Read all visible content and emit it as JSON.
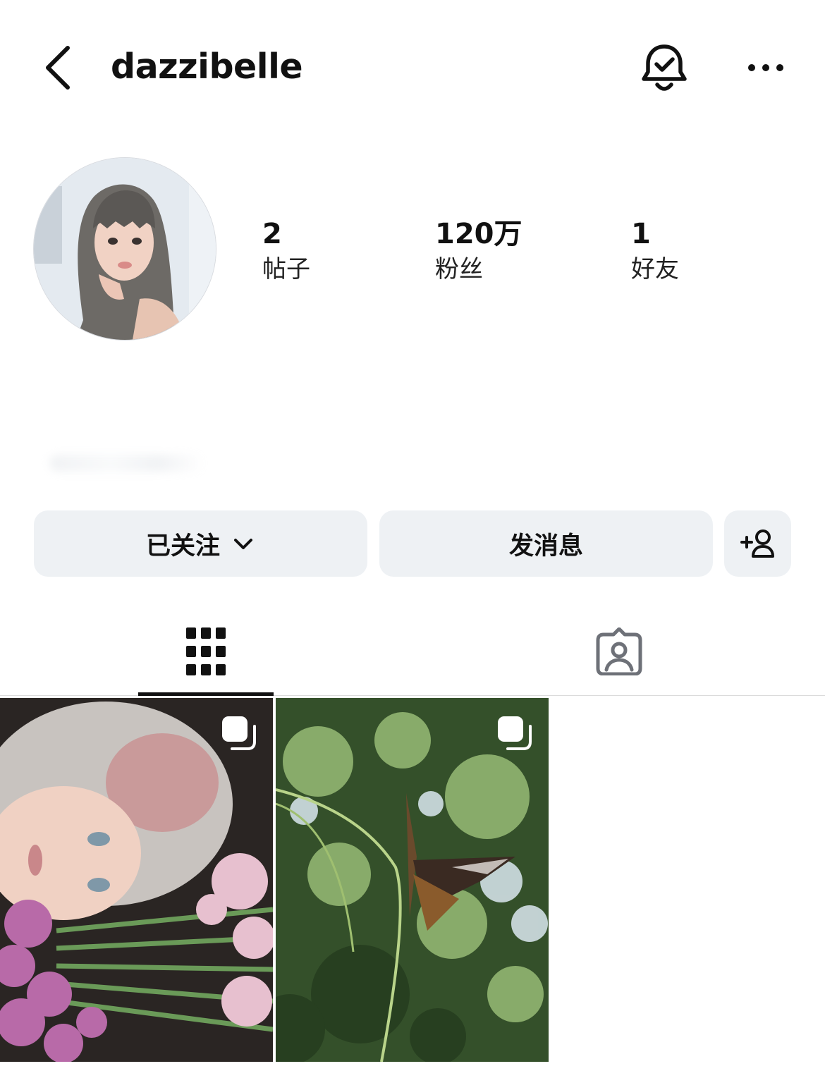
{
  "header": {
    "username": "dazzibelle",
    "back_icon": "chevron-left-icon",
    "notification_icon": "bell-check-icon",
    "more_icon": "ellipsis-icon"
  },
  "profile": {
    "avatar_icon": "profile-photo"
  },
  "stats": {
    "posts": {
      "value": "2",
      "label": "帖子"
    },
    "followers": {
      "value": "120万",
      "label": "粉丝"
    },
    "friends": {
      "value": "1",
      "label": "好友"
    }
  },
  "actions": {
    "following_label": "已关注",
    "message_label": "发消息",
    "add_friend_icon": "add-person-icon"
  },
  "tabs": {
    "posts_icon": "grid-icon",
    "tagged_icon": "tagged-person-icon",
    "active": "posts"
  },
  "colors": {
    "button_bg": "#eef1f4",
    "text": "#111111",
    "divider": "#dbdbdb"
  },
  "posts": [
    {
      "type": "carousel",
      "subject": "person-with-flowers"
    },
    {
      "type": "carousel",
      "subject": "butterfly-in-foliage"
    }
  ]
}
